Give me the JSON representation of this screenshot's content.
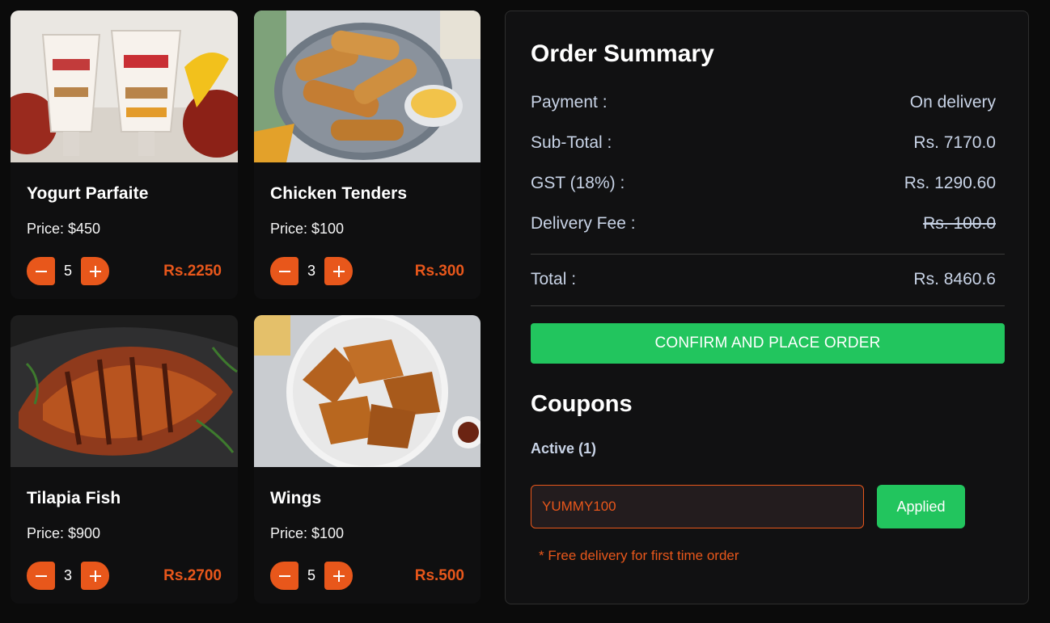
{
  "products": [
    {
      "name": "Yogurt Parfaite",
      "price": "Price: $450",
      "qty": "5",
      "total": "Rs.2250",
      "image": "yogurt-parfait-photo"
    },
    {
      "name": "Chicken Tenders",
      "price": "Price: $100",
      "qty": "3",
      "total": "Rs.300",
      "image": "chicken-tenders-photo"
    },
    {
      "name": "Tilapia Fish",
      "price": "Price: $900",
      "qty": "3",
      "total": "Rs.2700",
      "image": "grilled-tilapia-photo"
    },
    {
      "name": "Wings",
      "price": "Price: $100",
      "qty": "5",
      "total": "Rs.500",
      "image": "chicken-wings-photo"
    }
  ],
  "summary": {
    "title": "Order Summary",
    "payment_label": "Payment :",
    "payment_value": "On delivery",
    "subtotal_label": "Sub-Total :",
    "subtotal_value": "Rs. 7170.0",
    "gst_label": "GST (18%) :",
    "gst_value": "Rs. 1290.60",
    "delivery_label": "Delivery Fee :",
    "delivery_value": "Rs. 100.0",
    "total_label": "Total :",
    "total_value": "Rs. 8460.6",
    "confirm_label": "CONFIRM AND PLACE ORDER"
  },
  "coupons": {
    "title": "Coupons",
    "active_label": "Active (1)",
    "input_value": "YUMMY100",
    "applied_label": "Applied",
    "note": "* Free delivery for first time order"
  },
  "colors": {
    "accent": "#e8571b",
    "success": "#22c55e",
    "background": "#0b0b0b",
    "panel": "#111112"
  }
}
